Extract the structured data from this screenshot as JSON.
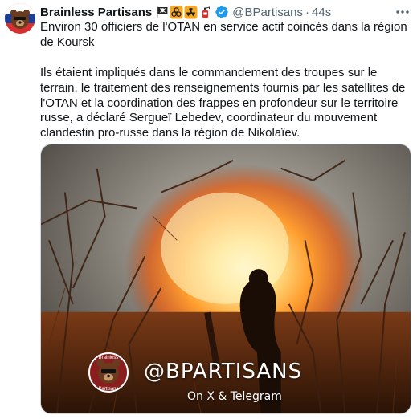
{
  "tweet": {
    "author_name": "Brainless Partisans",
    "handle": "@BPartisans",
    "separator": "·",
    "time": "44s",
    "name_emojis": [
      "pirate-flag-icon",
      "biohazard-icon",
      "radioactive-icon",
      "fire-extinguisher-icon"
    ],
    "verified_color": "#1d9bf0",
    "text_paragraph_1": "Environ 30 officiers de l'OTAN en service actif coincés dans la région de Koursk",
    "text_paragraph_2": "Ils étaient impliqués dans le commandement des troupes sur le terrain, le traitement des renseignements fournis par les satellites de l'OTAN et la coordination des frappes en profondeur sur le territoire russe, a déclaré Sergueï Lebedev, coordinateur du mouvement clandestin pro-russe dans la région de Nikolaïev."
  },
  "media": {
    "watermark_handle": "@BPARTISANS",
    "watermark_sub": "On X & Telegram",
    "watermark_logo_text_top": "Brainless",
    "watermark_logo_text_bottom": "Partisans"
  },
  "colors": {
    "text_primary": "#0f1419",
    "text_secondary": "#536471",
    "border": "#cfd9de"
  }
}
